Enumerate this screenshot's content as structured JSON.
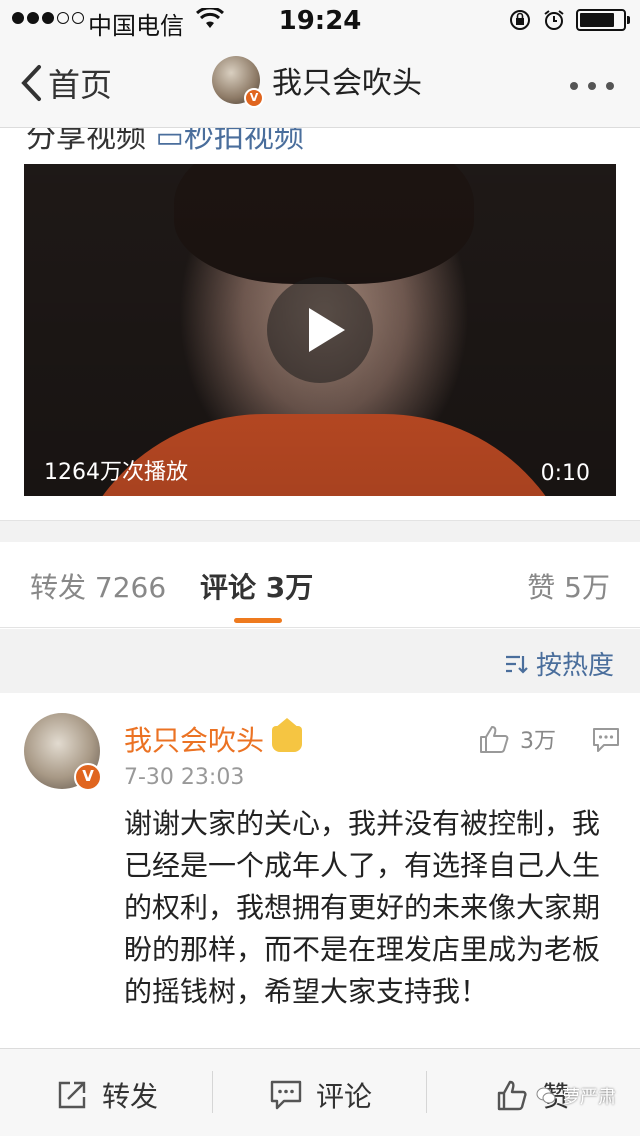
{
  "status_bar": {
    "carrier": "中国电信",
    "time": "19:24",
    "battery_level": 0.8
  },
  "nav": {
    "back_label": "首页",
    "title": "我只会吹头"
  },
  "post": {
    "source_prefix": "分享视频",
    "source_link": "秒拍视频",
    "video": {
      "plays": "1264万次播放",
      "duration": "0:10"
    }
  },
  "tabs": {
    "repost": "转发 7266",
    "comment": "评论 3万",
    "like": "赞 5万"
  },
  "sort_label": "按热度",
  "comment": {
    "author": "我只会吹头",
    "time": "7-30 23:03",
    "likes": "3万",
    "text": "谢谢大家的关心，我并没有被控制，我已经是一个成年人了，有选择自己人生的权利，我想拥有更好的未来像大家期盼的那样，而不是在理发店里成为老板的摇钱树，希望大家支持我！"
  },
  "bottom_bar": {
    "repost": "转发",
    "comment": "评论",
    "like": "赞"
  },
  "watermark": "萝严肃",
  "colors": {
    "accent": "#ee7a1e",
    "link": "#4a6e9c",
    "author": "#eb7223"
  }
}
